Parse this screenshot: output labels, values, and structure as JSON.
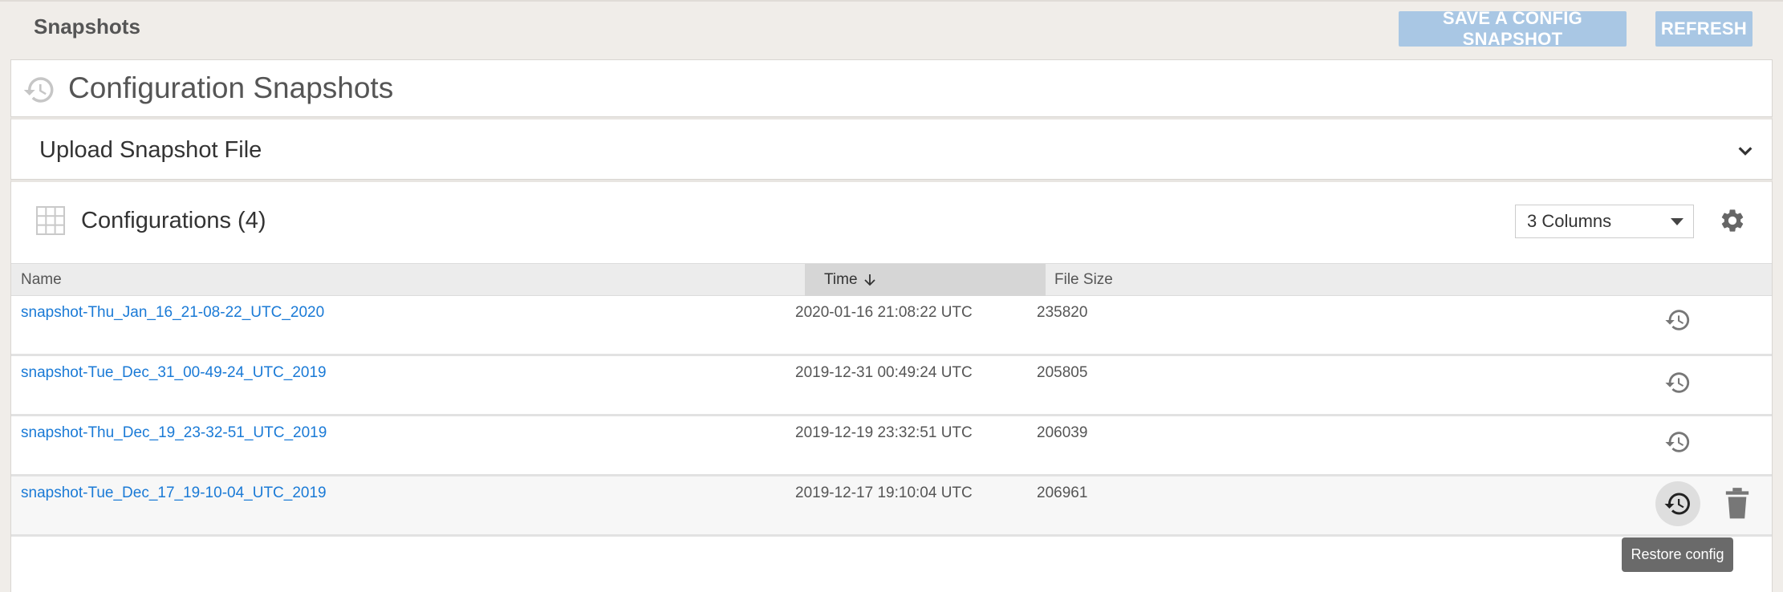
{
  "topbar": {
    "page_label": "Snapshots",
    "save_button": "SAVE A CONFIG SNAPSHOT",
    "refresh_button": "REFRESH"
  },
  "title_panel": {
    "icon": "history-icon",
    "title": "Configuration Snapshots"
  },
  "upload_panel": {
    "label": "Upload Snapshot File",
    "icon": "chevron-down-icon"
  },
  "configurations": {
    "icon": "grid-icon",
    "title": "Configurations (4)",
    "columns_select": "3 Columns",
    "settings_icon": "gear-icon",
    "headers": {
      "name": "Name",
      "time": "Time",
      "file_size": "File Size"
    },
    "rows": [
      {
        "name": "snapshot-Thu_Jan_16_21-08-22_UTC_2020",
        "time": "2020-01-16 21:08:22 UTC",
        "size": "235820"
      },
      {
        "name": "snapshot-Tue_Dec_31_00-49-24_UTC_2019",
        "time": "2019-12-31 00:49:24 UTC",
        "size": "205805"
      },
      {
        "name": "snapshot-Thu_Dec_19_23-32-51_UTC_2019",
        "time": "2019-12-19 23:32:51 UTC",
        "size": "206039"
      },
      {
        "name": "snapshot-Tue_Dec_17_19-10-04_UTC_2019",
        "time": "2019-12-17 19:10:04 UTC",
        "size": "206961"
      }
    ],
    "tooltip": "Restore config"
  },
  "colors": {
    "link": "#1a7ad6",
    "button_bg": "#a9c7e4",
    "header_bg": "#ececec",
    "sorted_header_bg": "#d6d6d6",
    "tooltip_bg": "#6a6a6a"
  }
}
